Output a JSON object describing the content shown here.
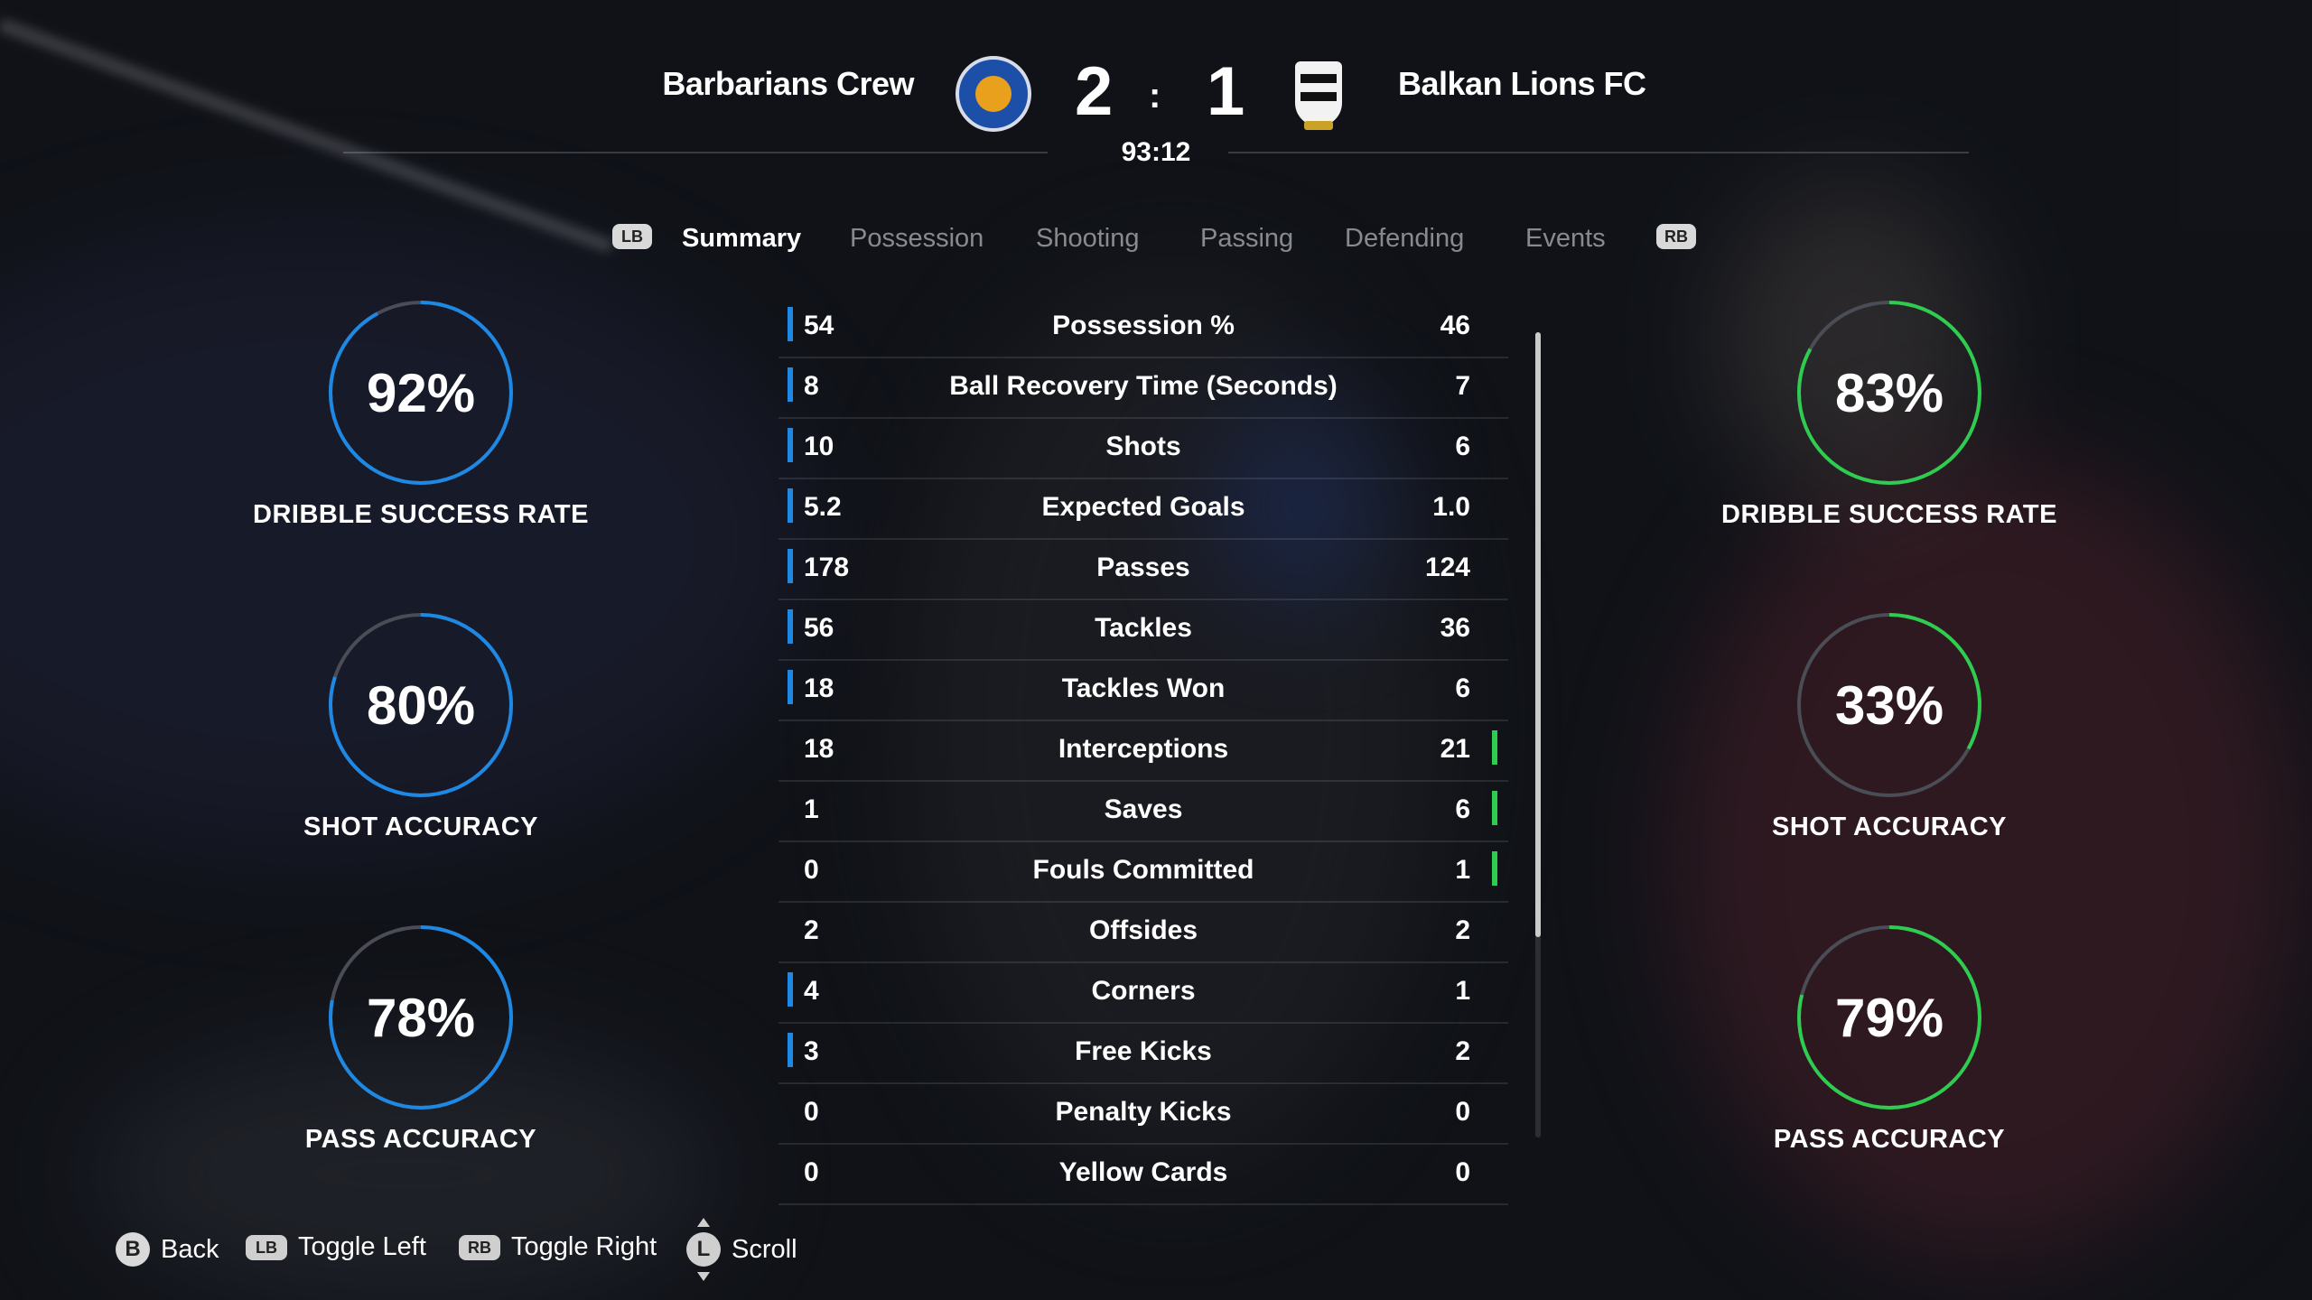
{
  "header": {
    "home_team": "Barbarians Crew",
    "away_team": "Balkan Lions FC",
    "home_score": "2",
    "away_score": "1",
    "separator": ":",
    "clock": "93:12"
  },
  "tabs": {
    "lb": "LB",
    "rb": "RB",
    "items": [
      "Summary",
      "Possession",
      "Shooting",
      "Passing",
      "Defending",
      "Events"
    ],
    "active": "Summary"
  },
  "home_rings": [
    {
      "value": "92%",
      "label": "DRIBBLE SUCCESS RATE",
      "fraction": 0.92
    },
    {
      "value": "80%",
      "label": "SHOT ACCURACY",
      "fraction": 0.8
    },
    {
      "value": "78%",
      "label": "PASS ACCURACY",
      "fraction": 0.78
    }
  ],
  "away_rings": [
    {
      "value": "83%",
      "label": "DRIBBLE SUCCESS RATE",
      "fraction": 0.83
    },
    {
      "value": "33%",
      "label": "SHOT ACCURACY",
      "fraction": 0.33
    },
    {
      "value": "79%",
      "label": "PASS ACCURACY",
      "fraction": 0.79
    }
  ],
  "colors": {
    "home_accent": "#1e88e5",
    "away_accent": "#2ecc4f",
    "ring_track": "#4a4d55"
  },
  "stats": [
    {
      "home": "54",
      "label": "Possession %",
      "away": "46",
      "leader": "home"
    },
    {
      "home": "8",
      "label": "Ball Recovery Time (Seconds)",
      "away": "7",
      "leader": "home"
    },
    {
      "home": "10",
      "label": "Shots",
      "away": "6",
      "leader": "home"
    },
    {
      "home": "5.2",
      "label": "Expected Goals",
      "away": "1.0",
      "leader": "home"
    },
    {
      "home": "178",
      "label": "Passes",
      "away": "124",
      "leader": "home"
    },
    {
      "home": "56",
      "label": "Tackles",
      "away": "36",
      "leader": "home"
    },
    {
      "home": "18",
      "label": "Tackles Won",
      "away": "6",
      "leader": "home"
    },
    {
      "home": "18",
      "label": "Interceptions",
      "away": "21",
      "leader": "away"
    },
    {
      "home": "1",
      "label": "Saves",
      "away": "6",
      "leader": "away"
    },
    {
      "home": "0",
      "label": "Fouls Committed",
      "away": "1",
      "leader": "away"
    },
    {
      "home": "2",
      "label": "Offsides",
      "away": "2",
      "leader": "none"
    },
    {
      "home": "4",
      "label": "Corners",
      "away": "1",
      "leader": "home"
    },
    {
      "home": "3",
      "label": "Free Kicks",
      "away": "2",
      "leader": "home"
    },
    {
      "home": "0",
      "label": "Penalty Kicks",
      "away": "0",
      "leader": "none"
    },
    {
      "home": "0",
      "label": "Yellow Cards",
      "away": "0",
      "leader": "none"
    }
  ],
  "footer": {
    "back_key": "B",
    "back_label": "Back",
    "toggle_left_key": "LB",
    "toggle_left_label": "Toggle Left",
    "toggle_right_key": "RB",
    "toggle_right_label": "Toggle Right",
    "scroll_key": "L",
    "scroll_label": "Scroll"
  }
}
